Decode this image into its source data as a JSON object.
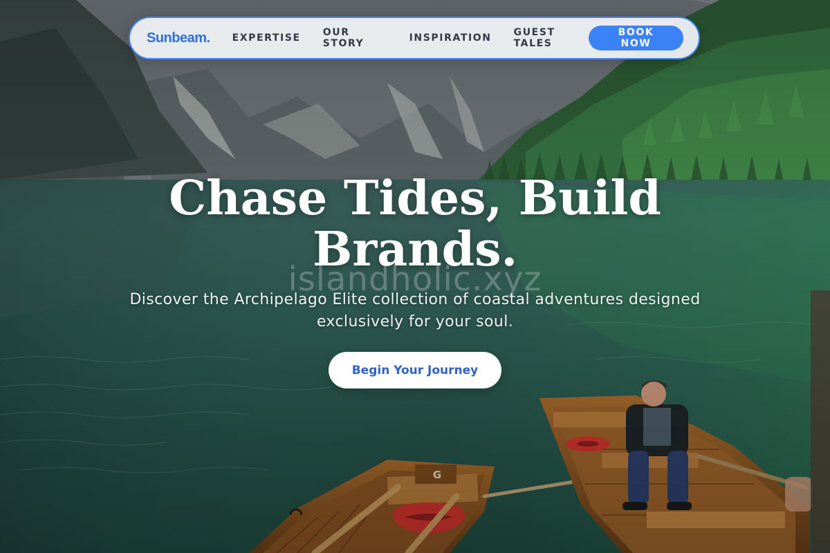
{
  "nav": {
    "brand": "Sunbeam.",
    "links": [
      "EXPERTISE",
      "OUR STORY",
      "INSPIRATION",
      "GUEST TALES"
    ],
    "cta_label": "BOOK NOW"
  },
  "hero": {
    "headline_line1": "Chase Tides, Build",
    "headline_line2": "Brands.",
    "watermark": "islandholic.xyz",
    "subtitle": "Discover the Archipelago Elite collection of coastal adventures designed exclusively for your soul.",
    "cta_label": "Begin Your Journey"
  },
  "colors": {
    "accent": "#3b82f6",
    "brand": "#2f6fd8",
    "nav_text": "#343b46",
    "cta_text": "#2f63c8"
  },
  "boats": {
    "left_label": "G"
  }
}
